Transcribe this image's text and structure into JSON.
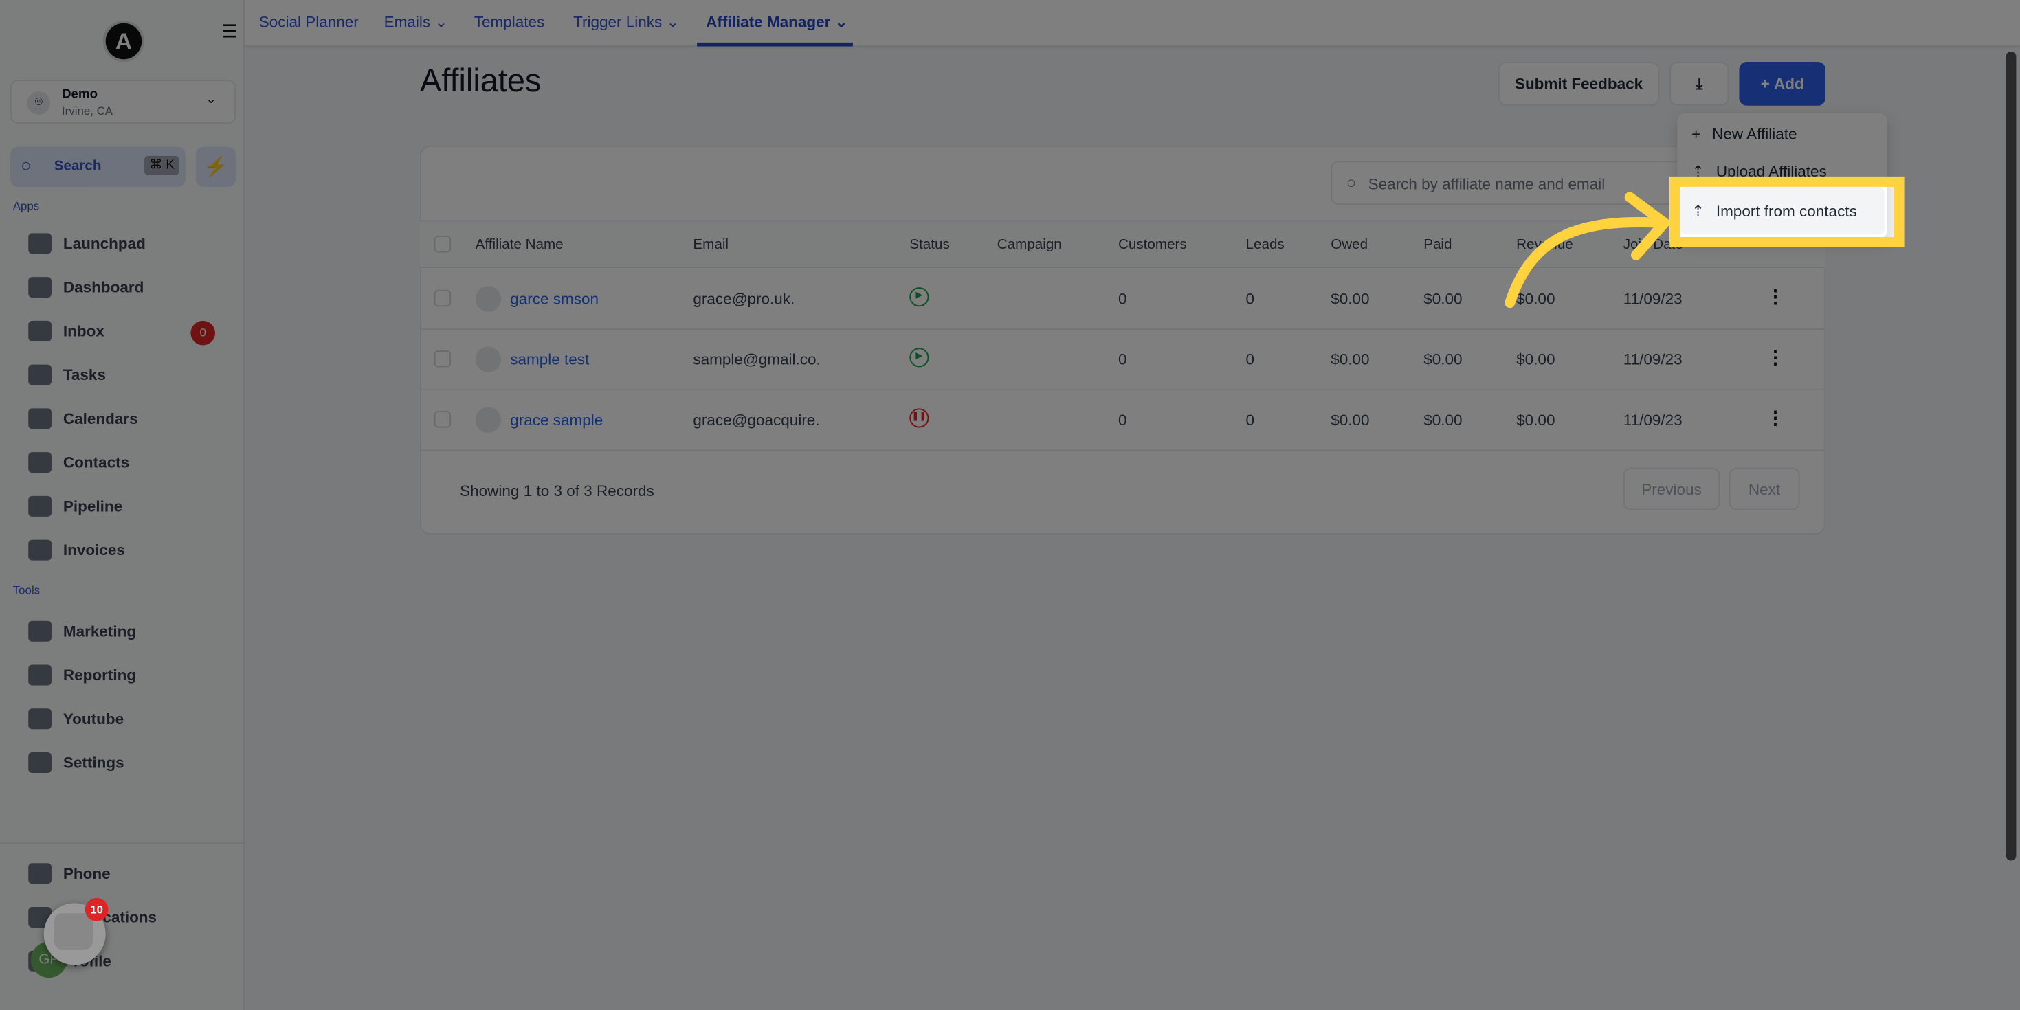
{
  "sidebar": {
    "logo": "A",
    "location": {
      "name": "Demo",
      "city": "Irvine, CA"
    },
    "search": {
      "label": "Search",
      "shortcut": "⌘ K"
    },
    "apps_label": "Apps",
    "apps": [
      {
        "label": "Launchpad"
      },
      {
        "label": "Dashboard"
      },
      {
        "label": "Inbox",
        "badge": "0"
      },
      {
        "label": "Tasks"
      },
      {
        "label": "Calendars"
      },
      {
        "label": "Contacts"
      },
      {
        "label": "Pipeline"
      },
      {
        "label": "Invoices"
      }
    ],
    "tools_label": "Tools",
    "tools": [
      {
        "label": "Marketing"
      },
      {
        "label": "Reporting"
      },
      {
        "label": "Youtube"
      },
      {
        "label": "Settings"
      }
    ],
    "bottom": [
      {
        "label": "Phone"
      },
      {
        "label": "Notifications"
      },
      {
        "label": "Profile"
      }
    ],
    "profile_initials": "GP",
    "chat_badge": "10"
  },
  "topnav": {
    "tabs": [
      "Social Planner",
      "Emails",
      "Templates",
      "Trigger Links",
      "Affiliate Manager"
    ],
    "active": "Affiliate Manager"
  },
  "page": {
    "title": "Affiliates",
    "submit_feedback": "Submit Feedback",
    "add": "Add"
  },
  "dropdown": {
    "items": [
      "New Affiliate",
      "Upload Affiliates",
      "Import from contacts"
    ],
    "highlighted": "Import from contacts"
  },
  "table": {
    "search_placeholder": "Search by affiliate name and email",
    "columns": [
      "Affiliate Name",
      "Email",
      "Status",
      "Campaign",
      "Customers",
      "Leads",
      "Owed",
      "Paid",
      "Revenue",
      "Join Date"
    ],
    "rows": [
      {
        "name": "garce smson",
        "email": "grace@pro.uk.",
        "status": "active",
        "campaign": "",
        "customers": "0",
        "leads": "0",
        "owed": "$0.00",
        "paid": "$0.00",
        "revenue": "$0.00",
        "join": "11/09/23"
      },
      {
        "name": "sample test",
        "email": "sample@gmail.co.",
        "status": "active",
        "campaign": "",
        "customers": "0",
        "leads": "0",
        "owed": "$0.00",
        "paid": "$0.00",
        "revenue": "$0.00",
        "join": "11/09/23"
      },
      {
        "name": "grace sample",
        "email": "grace@goacquire.",
        "status": "paused",
        "campaign": "",
        "customers": "0",
        "leads": "0",
        "owed": "$0.00",
        "paid": "$0.00",
        "revenue": "$0.00",
        "join": "11/09/23"
      }
    ],
    "footer": "Showing 1 to 3 of 3 Records",
    "previous": "Previous",
    "next": "Next"
  },
  "colors": {
    "accent": "#2f5fe8",
    "highlight": "#ffd23f",
    "active_status": "#16a34a",
    "paused_status": "#dc2626"
  }
}
